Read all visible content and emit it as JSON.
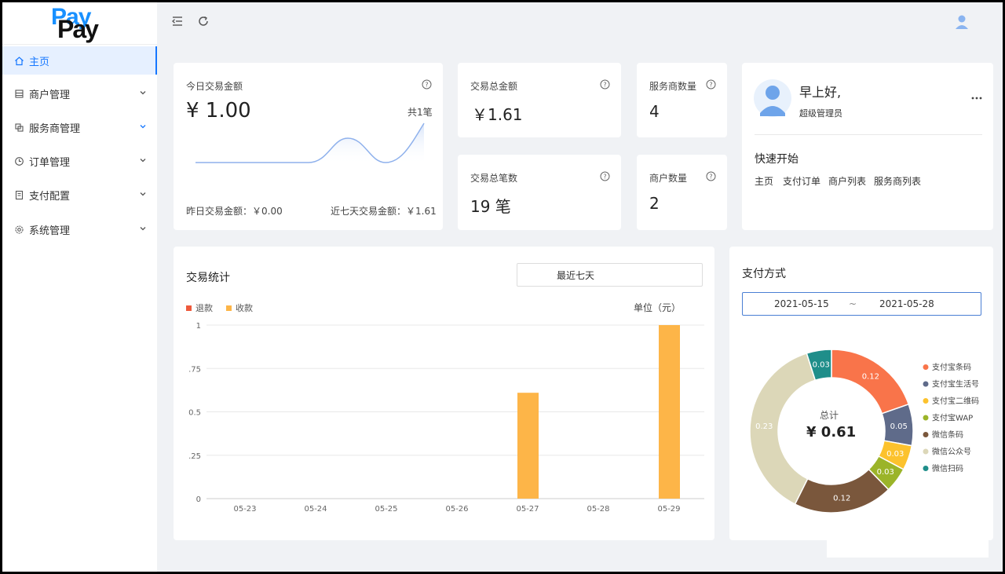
{
  "logo": {
    "top": "Pay",
    "bottom": "Pay"
  },
  "sidebar": {
    "items": [
      {
        "label": "主页",
        "icon": "home-icon",
        "active": true
      },
      {
        "label": "商户管理",
        "icon": "merchant-icon"
      },
      {
        "label": "服务商管理",
        "icon": "provider-icon"
      },
      {
        "label": "订单管理",
        "icon": "order-icon"
      },
      {
        "label": "支付配置",
        "icon": "config-icon"
      },
      {
        "label": "系统管理",
        "icon": "settings-icon"
      }
    ]
  },
  "today": {
    "title": "今日交易金额",
    "amount": "¥ 1.00",
    "count": "共1笔",
    "yesterday": "昨日交易金额：￥0.00",
    "week": "近七天交易金额：￥1.61"
  },
  "stats": {
    "total_amount_title": "交易总金额",
    "total_amount": "￥1.61",
    "total_count_title": "交易总笔数",
    "total_count": "19 笔",
    "provider_title": "服务商数量",
    "provider_count": "4",
    "merchant_title": "商户数量",
    "merchant_count": "2"
  },
  "welcome": {
    "greeting": "早上好,",
    "role": "超级管理员",
    "quick_title": "快速开始",
    "links": [
      "主页",
      "支付订单",
      "商户列表",
      "服务商列表"
    ]
  },
  "trade_stats": {
    "title": "交易统计",
    "range_select": "最近七天",
    "unit": "单位（元）",
    "legend_refund": "退款",
    "legend_receive": "收款"
  },
  "payment": {
    "title": "支付方式",
    "date_start": "2021-05-15",
    "date_sep": "~",
    "date_end": "2021-05-28",
    "total_label": "总计",
    "total_value": "¥ 0.61"
  },
  "colors": {
    "refund": "#ee5a3c",
    "receive": "#fdb548",
    "accent": "#1677ff"
  },
  "chart_data": [
    {
      "type": "bar",
      "categories": [
        "05-23",
        "05-24",
        "05-25",
        "05-26",
        "05-27",
        "05-28",
        "05-29"
      ],
      "series": [
        {
          "name": "退款",
          "values": [
            0,
            0,
            0,
            0,
            0,
            0,
            0
          ]
        },
        {
          "name": "收款",
          "values": [
            0,
            0,
            0,
            0,
            0.61,
            0,
            1
          ]
        }
      ],
      "y_ticks": [
        "0",
        ".25",
        "0.5",
        ".75",
        "1"
      ],
      "ylim": [
        0,
        1
      ],
      "grid": true,
      "legend": "top-left"
    },
    {
      "type": "pie",
      "donut": true,
      "labels": [
        "支付宝条码",
        "支付宝生活号",
        "支付宝二维码",
        "支付宝WAP",
        "微信条码",
        "微信公众号",
        "微信扫码"
      ],
      "values": [
        0.12,
        0.05,
        0.03,
        0.03,
        0.12,
        0.23,
        0.03
      ],
      "value_labels": [
        "0.12",
        "0.05",
        "0.03",
        "0.03",
        "0.12",
        "0.23",
        "0.03"
      ],
      "colors": [
        "#f9744a",
        "#5f6b8a",
        "#fcc22d",
        "#9bb429",
        "#7a573c",
        "#dcd7b8",
        "#1f8e8a"
      ],
      "legend": "right"
    }
  ]
}
